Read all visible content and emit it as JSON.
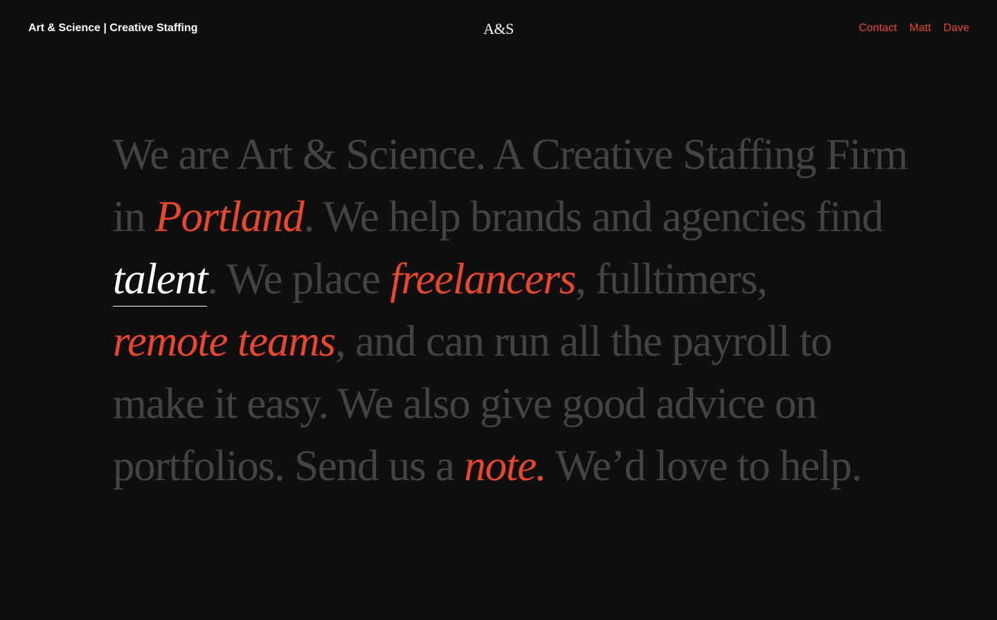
{
  "header": {
    "brand": "Art & Science | Creative Staffing",
    "logo": "A&S",
    "nav": [
      {
        "label": "Contact"
      },
      {
        "label": "Matt"
      },
      {
        "label": "Dave"
      }
    ]
  },
  "hero": {
    "l1": "We are Art & Science. A Creative Staffing Firm",
    "l2_a": "in ",
    "l2_city": "Portland",
    "l2_b": ". We help brands and agencies find",
    "l3_talent": "talent",
    "l3_a": ". We place ",
    "l3_freelancers": "freelancers",
    "l3_b": ", fulltimers,",
    "l4_remote": "remote teams",
    "l4_a": ", and can run all the payroll to",
    "l5": "make it easy. We also give good advice on",
    "l6_a": "portfolios. Send us a ",
    "l6_note": "note.",
    "l6_b": " We’d love to help."
  },
  "colors": {
    "background": "#0f0f0f",
    "accent": "#e8472c",
    "muted_text": "#434343",
    "highlight": "#ffffff"
  }
}
